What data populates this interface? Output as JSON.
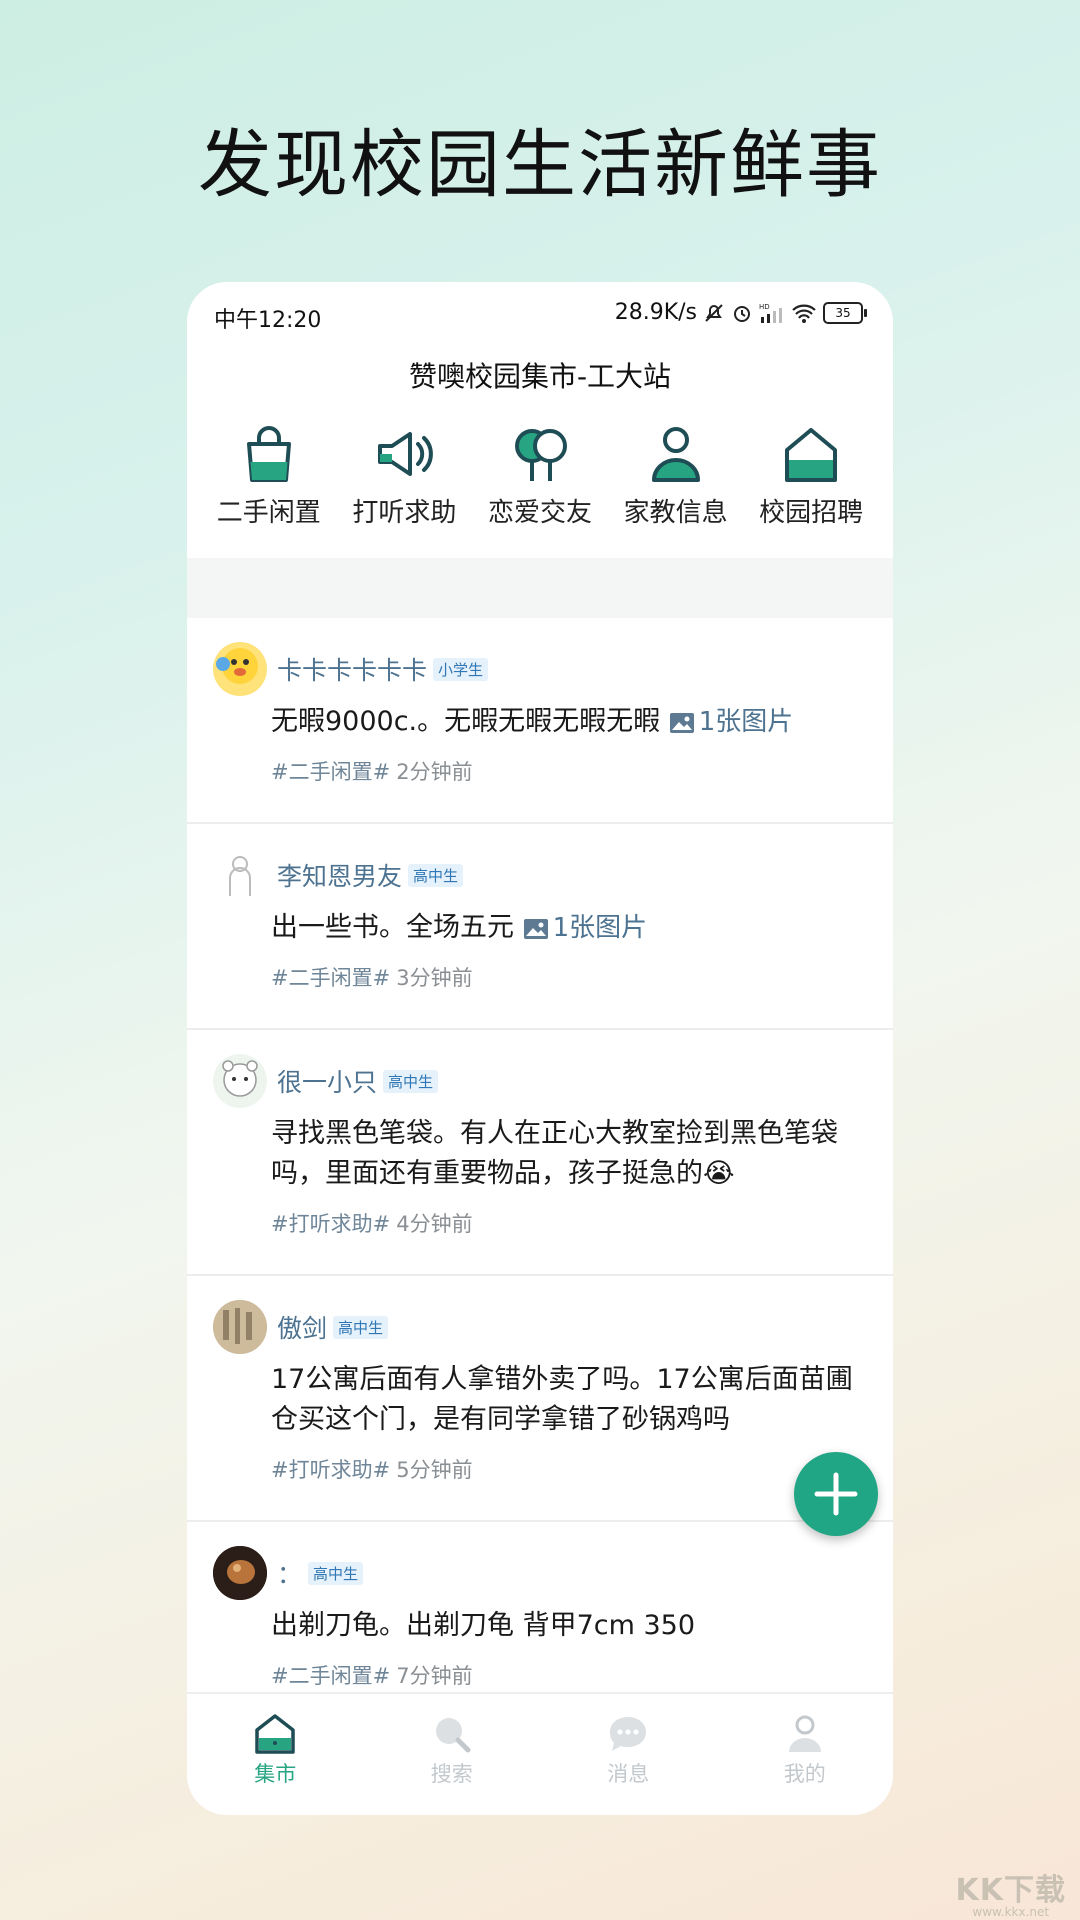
{
  "headline": "发现校园生活新鲜事",
  "status": {
    "time": "中午12:20",
    "speed": "28.9K/s",
    "hd": "HD",
    "battery": "35"
  },
  "app": {
    "title": "赞噢校园集市-工大站"
  },
  "categories": [
    {
      "label": "二手闲置",
      "icon": "shopping-bag-icon"
    },
    {
      "label": "打听求助",
      "icon": "megaphone-icon"
    },
    {
      "label": "恋爱交友",
      "icon": "balloons-icon"
    },
    {
      "label": "家教信息",
      "icon": "person-icon"
    },
    {
      "label": "校园招聘",
      "icon": "house-icon"
    }
  ],
  "posts": [
    {
      "user": "卡卡卡卡卡卡",
      "badge": "小学生",
      "text": "无暇9000c.。无暇无暇无暇无暇",
      "image_tag": "1张图片",
      "tag": "#二手闲置#",
      "time": "2分钟前"
    },
    {
      "user": "李知恩男友",
      "badge": "高中生",
      "text": "出一些书。全场五元",
      "image_tag": "1张图片",
      "tag": "#二手闲置#",
      "time": "3分钟前"
    },
    {
      "user": "很一小只",
      "badge": "高中生",
      "text": "寻找黑色笔袋。有人在正心大教室捡到黑色笔袋吗，里面还有重要物品，孩子挺急的😭",
      "image_tag": "",
      "tag": "#打听求助#",
      "time": "4分钟前"
    },
    {
      "user": "傲剑",
      "badge": "高中生",
      "text": "17公寓后面有人拿错外卖了吗。17公寓后面苗圃仓买这个门，是有同学拿错了砂锅鸡吗",
      "image_tag": "",
      "tag": "#打听求助#",
      "time": "5分钟前"
    },
    {
      "user": "：",
      "badge": "高中生",
      "text": "出剃刀龟。出剃刀龟 背甲7cm 350",
      "image_tag": "",
      "tag": "#二手闲置#",
      "time": "7分钟前"
    }
  ],
  "tabs": [
    {
      "label": "集市",
      "active": true
    },
    {
      "label": "搜索",
      "active": false
    },
    {
      "label": "消息",
      "active": false
    },
    {
      "label": "我的",
      "active": false
    }
  ],
  "watermark": {
    "main": "KK下载",
    "sub": "www.kkx.net"
  },
  "colors": {
    "accent": "#27a582",
    "fab": "#21a685",
    "username": "#4d7391"
  }
}
